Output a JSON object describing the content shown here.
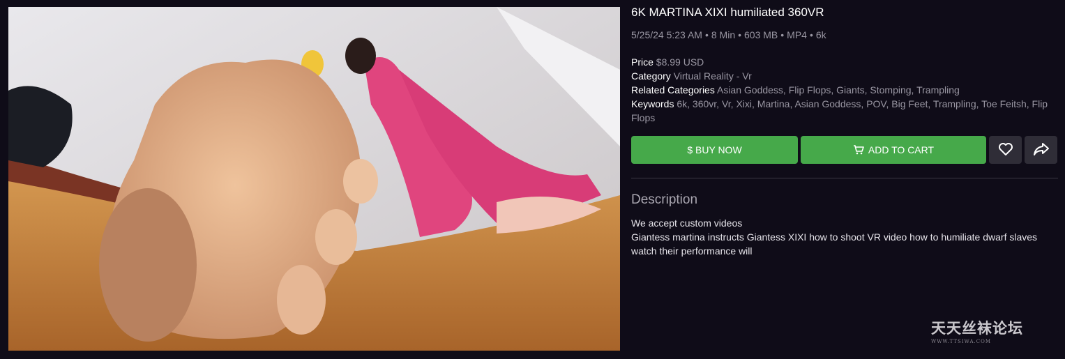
{
  "product": {
    "title": "6K MARTINA XIXI humiliated 360VR",
    "meta": {
      "date": "5/25/24 5:23 AM",
      "duration": "8 Min",
      "size": "603 MB",
      "format": "MP4",
      "resolution": "6k",
      "separator": "•"
    },
    "price_label": "Price",
    "price_value": "$8.99 USD",
    "category_label": "Category",
    "category_value": "Virtual Reality - Vr",
    "related_label": "Related Categories",
    "related_value": "Asian Goddess, Flip Flops, Giants, Stomping, Trampling",
    "keywords_label": "Keywords",
    "keywords_value": "6k, 360vr, Vr, Xixi, Martina, Asian Goddess, POV, Big Feet, Trampling, Toe Feitsh, Flip Flops"
  },
  "actions": {
    "buy_label": "$ BUY NOW",
    "cart_label": "ADD TO CART",
    "fav_icon": "heart-icon",
    "share_icon": "share-icon"
  },
  "description": {
    "heading": "Description",
    "line1": "We accept custom videos",
    "line2": "Giantess martina instructs Giantess XIXI how to shoot VR video how to humiliate dwarf slaves watch their performance will"
  },
  "watermark": {
    "main": "天天丝袜论坛",
    "sub": "WWW.TTSIWA.COM"
  },
  "colors": {
    "background": "#0f0c18",
    "button_green": "#46a94a",
    "button_dark": "#2f2d37",
    "muted_text": "#9a97a3"
  }
}
